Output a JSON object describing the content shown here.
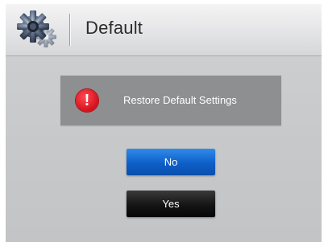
{
  "header": {
    "title": "Default",
    "icon": "gear-icon"
  },
  "alert": {
    "icon": "exclamation-icon",
    "icon_glyph": "!",
    "message": "Restore Default Settings"
  },
  "buttons": {
    "no_label": "No",
    "yes_label": "Yes"
  },
  "colors": {
    "alert_panel": "#8e8f91",
    "alert_icon": "#e0141f",
    "no_button": "#1468d4",
    "yes_button": "#111111"
  }
}
